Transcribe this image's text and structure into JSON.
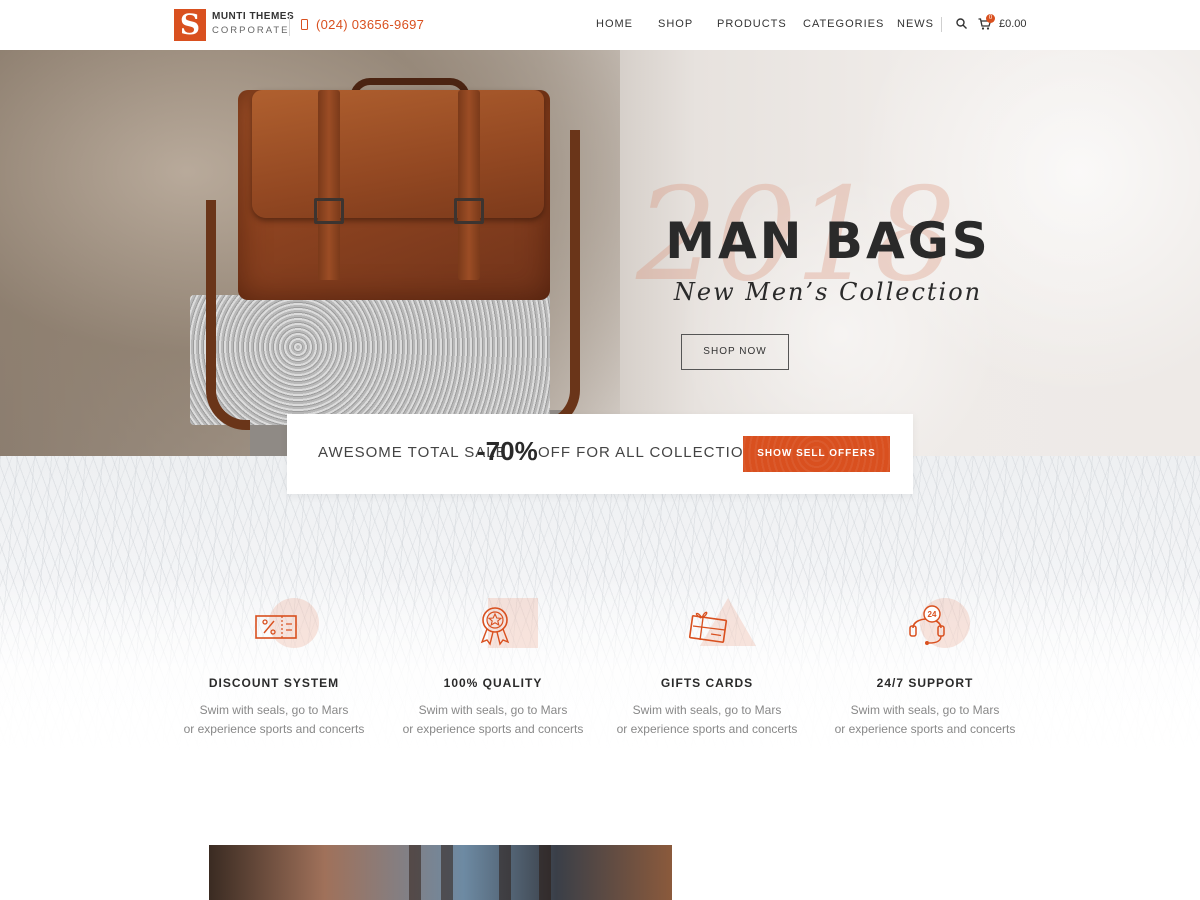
{
  "brand": {
    "logo_letter": "S",
    "name_line1": "MUNTI THEMES",
    "name_line2": "CORPORATE",
    "phone": "(024) 03656-9697"
  },
  "nav": {
    "items": [
      "HOME",
      "SHOP",
      "PRODUCTS",
      "CATEGORIES",
      "NEWS"
    ],
    "cart_count": "0",
    "cart_total": "£0.00"
  },
  "hero": {
    "year": "2018",
    "title": "MAN BAGS",
    "subtitle": "New Men’s Collection",
    "button": "SHOP NOW"
  },
  "sale": {
    "text_before": "AWESOME TOTAL SALE",
    "percent": "-70%",
    "text_after": "OFF FOR ALL COLLECTION",
    "button": "SHOW SELL OFFERS"
  },
  "features": [
    {
      "title": "DISCOUNT SYSTEM",
      "desc_line1": "Swim with seals, go to Mars",
      "desc_line2": "or experience sports and concerts",
      "icon": "discount-ticket-icon"
    },
    {
      "title": "100% QUALITY",
      "desc_line1": "Swim with seals, go to Mars",
      "desc_line2": "or experience sports and concerts",
      "icon": "quality-badge-icon"
    },
    {
      "title": "GIFTS CARDS",
      "desc_line1": "Swim with seals, go to Mars",
      "desc_line2": "or experience sports and concerts",
      "icon": "gift-card-icon"
    },
    {
      "title": "24/7 SUPPORT",
      "desc_line1": "Swim with seals, go to Mars",
      "desc_line2": "or experience sports and concerts",
      "icon": "support-headset-icon"
    }
  ],
  "support_icon_label": "24",
  "colors": {
    "accent": "#d9501f",
    "text_dark": "#2a2a2a",
    "text_muted": "#888888"
  }
}
